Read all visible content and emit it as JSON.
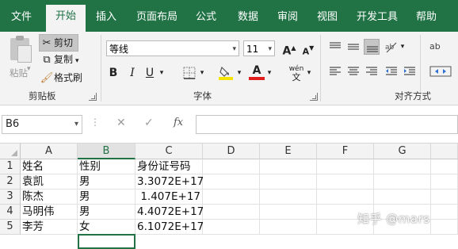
{
  "tabs": [
    "文件",
    "开始",
    "插入",
    "页面布局",
    "公式",
    "数据",
    "审阅",
    "视图",
    "开发工具",
    "帮助"
  ],
  "active_tab": "开始",
  "ribbon": {
    "clipboard": {
      "paste_label": "粘贴",
      "cut_label": "剪切",
      "copy_label": "复制",
      "format_painter_label": "格式刷",
      "group_label": "剪贴板"
    },
    "font": {
      "font_name": "等线",
      "font_size": "11",
      "bold": "B",
      "italic": "I",
      "underline": "U",
      "font_color_glyph": "A",
      "phonetic_glyph": "wén",
      "group_label": "字体",
      "fill_color": "#f5e400",
      "font_color": "#e01e1e"
    },
    "alignment": {
      "wrap_glyph": "ab",
      "group_label": "对齐方式"
    }
  },
  "formula_bar": {
    "name_box": "B6",
    "cancel_icon": "✕",
    "enter_icon": "✓",
    "fx_label": "fx",
    "value": ""
  },
  "sheet": {
    "columns": [
      "A",
      "B",
      "C",
      "D",
      "E",
      "F",
      "G"
    ],
    "selected_column": "B",
    "rows": [
      "1",
      "2",
      "3",
      "4",
      "5"
    ],
    "cells": [
      [
        "姓名",
        "性别",
        "身份证号码"
      ],
      [
        "袁凯",
        "男",
        "3.3072E+17"
      ],
      [
        "陈杰",
        "男",
        "1.407E+17"
      ],
      [
        "马明伟",
        "男",
        "4.4072E+17"
      ],
      [
        "李芳",
        "女",
        "6.1072E+17"
      ]
    ]
  },
  "watermark": "知乎 @mars",
  "colors": {
    "excel_green": "#217346",
    "ribbon_bg": "#f3f3f3"
  }
}
